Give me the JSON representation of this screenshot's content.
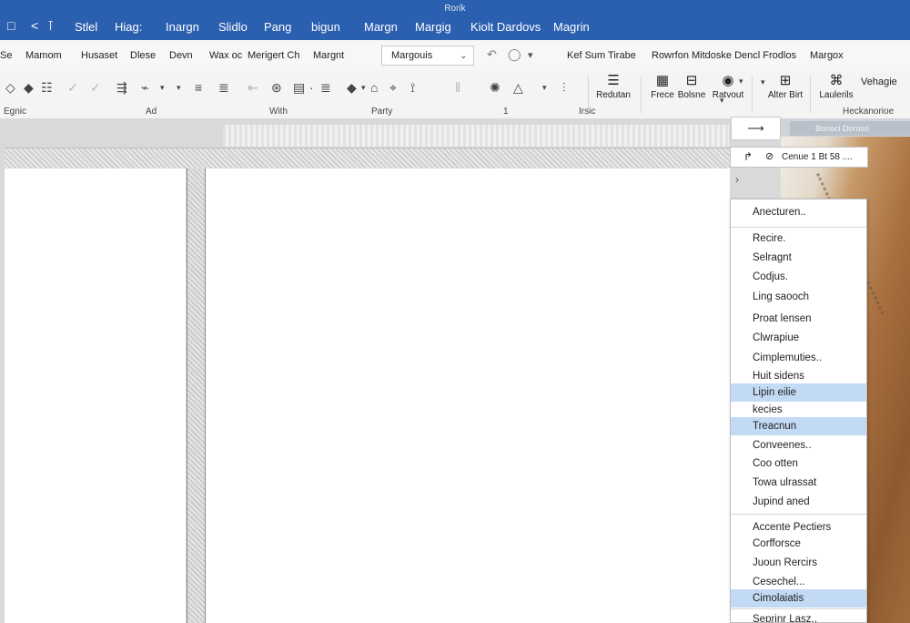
{
  "app_title": "Rorik",
  "quick_access": {
    "window_icon": "□",
    "undo_icon": "<",
    "redo_icon": "⊺"
  },
  "menu_tabs": [
    "Stlel",
    "Hiag:",
    "Inargn",
    "Slidlo",
    "Pang",
    "bigun",
    "Margn",
    "Margig",
    "Kiolt Dardovs",
    "Magrin"
  ],
  "ribbon_row1": {
    "items": [
      "Se",
      "Mamom",
      "Husaset",
      "Dlese",
      "Devn",
      "Wax oc",
      "Merigert Ch",
      "Margnt"
    ],
    "dropdown": {
      "value": "Margouis",
      "chevron": "⌄"
    },
    "tools": [
      "↶",
      "◯",
      "▾"
    ],
    "right_items": [
      "Kef Sum Tirabe",
      "Rowrfon Mitdoske Dencl Frodlos",
      "Margox"
    ]
  },
  "ribbon_row2": {
    "icons": [
      "◇",
      "◆",
      "☷",
      "✓",
      "✓",
      "⇶",
      "⌁",
      "▾",
      "▾",
      "≡",
      "≣",
      "⇤",
      "⊛",
      "▤",
      "·",
      "≣",
      "◆",
      "▾",
      "⌂",
      "⌖",
      "⟟",
      "⦀",
      "✺",
      "△",
      "▾",
      "⫶"
    ],
    "big_buttons": [
      {
        "icon": "☰",
        "label": "Redutan"
      },
      {
        "icon": "▦",
        "label": "Frece"
      },
      {
        "icon": "⊟",
        "label": "Bolsne"
      },
      {
        "icon": "◉",
        "label": "Ratvout"
      },
      {
        "icon": "⊞",
        "label": "Alter Birt"
      },
      {
        "icon": "⌘",
        "label": "Laulerils"
      }
    ],
    "dropdown_arrow": "▾",
    "more_arrow": "▾",
    "vehagie": "Vehagie",
    "group_labels": [
      "Egnic",
      "Ad",
      "With",
      "Party",
      "1",
      "Irsic",
      "Heckanorioe"
    ]
  },
  "right_panel": {
    "arrow_button": "⟶",
    "tag": "Bonoci Doruso",
    "search_text": "Cenue 1 Bt 58 ....",
    "search_icon1": "↱",
    "search_icon2": "⊘",
    "side_chevron": "›",
    "highlight_color": "#c3daf5"
  },
  "context_menu": {
    "items": [
      "Anecturen..",
      "Recire.",
      "Selragnt",
      "Codjus.",
      "Ling saooch",
      "Proat lensen",
      "Clwrapiue",
      "Cimplemuties..",
      "Huit sidens",
      "Lipin eilie",
      "kecies",
      "Treacnun",
      "Conveenes..",
      "Coo otten",
      "Towa ulrassat",
      "Jupind aned",
      "Accente Pectiers",
      "Corfforsce",
      "Juoun Rercirs",
      "Cesechel...",
      "Cimolaiatis",
      "Seprinr Lasz.."
    ],
    "highlighted": [
      "Lipin eilie",
      "Treacnun",
      "Cimolaiatis"
    ]
  }
}
